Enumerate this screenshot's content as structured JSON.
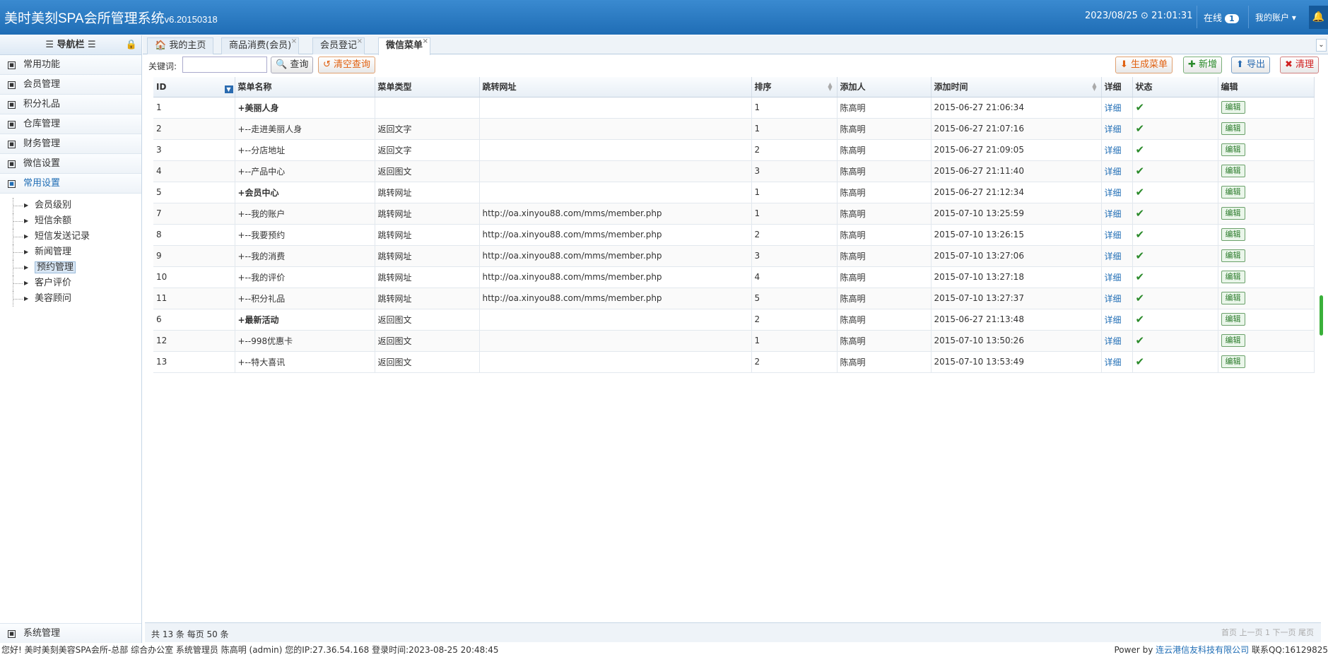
{
  "header": {
    "title": "美时美刻SPA会所管理系统",
    "version": "v6.20150318",
    "datetime": "2023/08/25 ⊙ 21:01:31",
    "online_label": "在线",
    "online_count": "1",
    "account_label": "我的账户 ▾"
  },
  "sidebar": {
    "header": "☰ 导航栏 ☰",
    "sections": [
      {
        "label": "常用功能"
      },
      {
        "label": "会员管理"
      },
      {
        "label": "积分礼品"
      },
      {
        "label": "仓库管理"
      },
      {
        "label": "财务管理"
      },
      {
        "label": "微信设置"
      },
      {
        "label": "常用设置"
      }
    ],
    "tree": [
      {
        "label": "会员级别"
      },
      {
        "label": "短信余额"
      },
      {
        "label": "短信发送记录"
      },
      {
        "label": "新闻管理"
      },
      {
        "label": "预约管理"
      },
      {
        "label": "客户评价"
      },
      {
        "label": "美容顾问"
      }
    ],
    "bottom_section": "系统管理"
  },
  "tabs": [
    {
      "label": "🏠 我的主页"
    },
    {
      "label": "商品消费(会员)"
    },
    {
      "label": "会员登记"
    },
    {
      "label": "微信菜单"
    }
  ],
  "toolbar": {
    "keyword_label": "关键词:",
    "keyword_value": "",
    "query_label": "🔍 查询",
    "clear_label": "↺ 清空查询",
    "gen_label": "⬇ 生成菜单",
    "add_label": "✚ 新增",
    "export_label": "⬆ 导出",
    "clean_label": "✖ 清理"
  },
  "table": {
    "columns": [
      "ID",
      "菜单名称",
      "菜单类型",
      "跳转网址",
      "排序",
      "添加人",
      "添加时间",
      "详细",
      "状态",
      "编辑"
    ],
    "detail_label": "详细",
    "edit_label": "编辑",
    "rows": [
      {
        "id": "1",
        "name": "+美丽人身",
        "type": "",
        "url": "",
        "sort": "1",
        "by": "陈高明",
        "time": "2015-06-27 21:06:34",
        "bold": true
      },
      {
        "id": "2",
        "name": "+--走进美丽人身",
        "type": "返回文字",
        "url": "",
        "sort": "1",
        "by": "陈高明",
        "time": "2015-06-27 21:07:16",
        "bold": false
      },
      {
        "id": "3",
        "name": "+--分店地址",
        "type": "返回文字",
        "url": "",
        "sort": "2",
        "by": "陈高明",
        "time": "2015-06-27 21:09:05",
        "bold": false
      },
      {
        "id": "4",
        "name": "+--产品中心",
        "type": "返回图文",
        "url": "",
        "sort": "3",
        "by": "陈高明",
        "time": "2015-06-27 21:11:40",
        "bold": false
      },
      {
        "id": "5",
        "name": "+会员中心",
        "type": "跳转网址",
        "url": "",
        "sort": "1",
        "by": "陈高明",
        "time": "2015-06-27 21:12:34",
        "bold": true
      },
      {
        "id": "7",
        "name": "+--我的账户",
        "type": "跳转网址",
        "url": "http://oa.xinyou88.com/mms/member.php",
        "sort": "1",
        "by": "陈高明",
        "time": "2015-07-10 13:25:59",
        "bold": false
      },
      {
        "id": "8",
        "name": "+--我要预约",
        "type": "跳转网址",
        "url": "http://oa.xinyou88.com/mms/member.php",
        "sort": "2",
        "by": "陈高明",
        "time": "2015-07-10 13:26:15",
        "bold": false
      },
      {
        "id": "9",
        "name": "+--我的消费",
        "type": "跳转网址",
        "url": "http://oa.xinyou88.com/mms/member.php",
        "sort": "3",
        "by": "陈高明",
        "time": "2015-07-10 13:27:06",
        "bold": false
      },
      {
        "id": "10",
        "name": "+--我的评价",
        "type": "跳转网址",
        "url": "http://oa.xinyou88.com/mms/member.php",
        "sort": "4",
        "by": "陈高明",
        "time": "2015-07-10 13:27:18",
        "bold": false
      },
      {
        "id": "11",
        "name": "+--积分礼品",
        "type": "跳转网址",
        "url": "http://oa.xinyou88.com/mms/member.php",
        "sort": "5",
        "by": "陈高明",
        "time": "2015-07-10 13:27:37",
        "bold": false
      },
      {
        "id": "6",
        "name": "+最新活动",
        "type": "返回图文",
        "url": "",
        "sort": "2",
        "by": "陈高明",
        "time": "2015-06-27 21:13:48",
        "bold": true
      },
      {
        "id": "12",
        "name": "+--998优惠卡",
        "type": "返回图文",
        "url": "",
        "sort": "1",
        "by": "陈高明",
        "time": "2015-07-10 13:50:26",
        "bold": false
      },
      {
        "id": "13",
        "name": "+--特大喜讯",
        "type": "返回图文",
        "url": "",
        "sort": "2",
        "by": "陈高明",
        "time": "2015-07-10 13:53:49",
        "bold": false
      }
    ]
  },
  "pager": {
    "info": "共 13 条 每页 50 条",
    "nav": "首页  上一页  1  下一页  尾页"
  },
  "statusbar": {
    "left": "您好! 美时美刻美容SPA会所-总部 综合办公室 系统管理员 陈高明 (admin) 您的IP:27.36.54.168 登录时间:2023-08-25 20:48:45",
    "power": "Power by",
    "company": "连云港信友科技有限公司",
    "contact": "联系QQ:16129825"
  }
}
